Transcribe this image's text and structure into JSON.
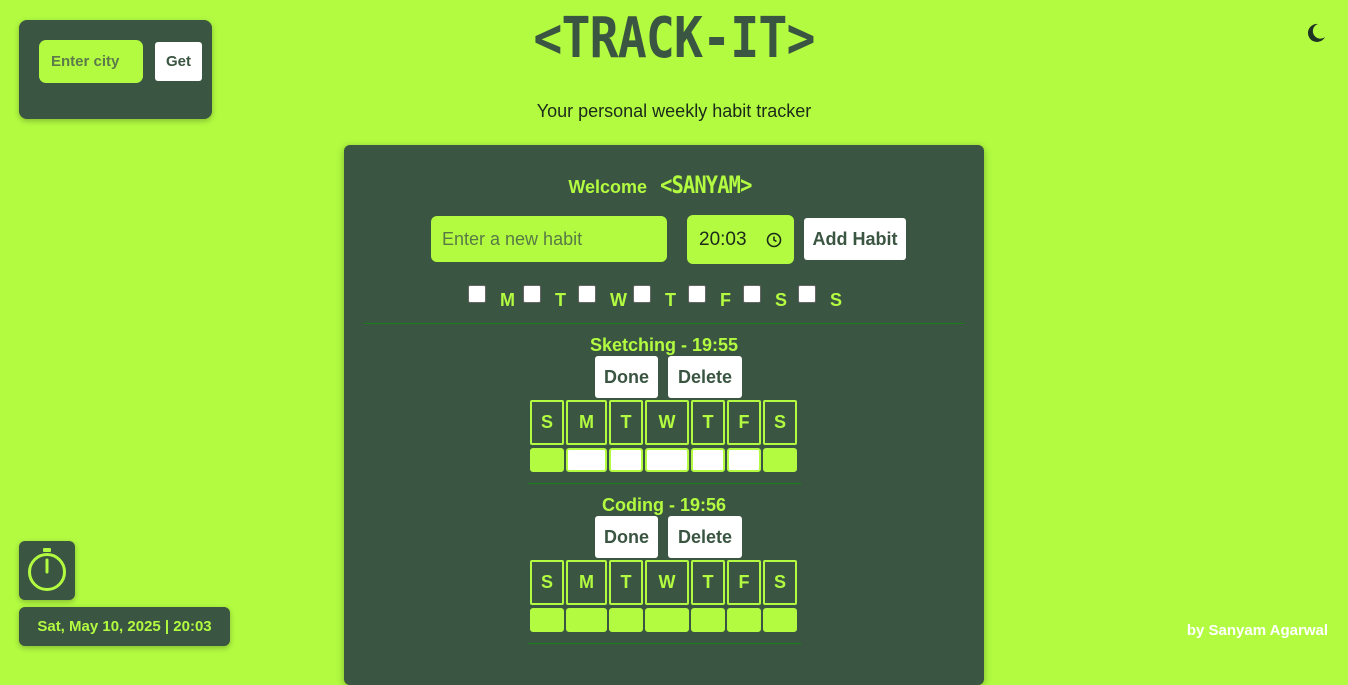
{
  "header": {
    "title": "<TRACK-IT>",
    "subtitle": "Your personal weekly habit tracker",
    "dark_mode_icon": "moon-icon"
  },
  "weather": {
    "city_placeholder": "Enter city",
    "get_label": "Get"
  },
  "panel": {
    "welcome_label": "Welcome",
    "username": "<SANYAM>",
    "habit_placeholder": "Enter a new habit",
    "time_value": "20:03",
    "clock_icon": "clock-icon",
    "add_label": "Add Habit",
    "day_options": [
      "M",
      "T",
      "W",
      "T",
      "F",
      "S",
      "S"
    ]
  },
  "habits": [
    {
      "title": "Sketching - 19:55",
      "done_label": "Done",
      "delete_label": "Delete",
      "days": [
        "S",
        "M",
        "T",
        "W",
        "T",
        "F",
        "S"
      ],
      "scheduled": [
        false,
        true,
        true,
        true,
        true,
        true,
        false
      ]
    },
    {
      "title": "Coding - 19:56",
      "done_label": "Done",
      "delete_label": "Delete",
      "days": [
        "S",
        "M",
        "T",
        "W",
        "T",
        "F",
        "S"
      ],
      "scheduled": [
        false,
        false,
        false,
        false,
        false,
        false,
        false
      ]
    }
  ],
  "footer": {
    "timer_icon": "stopwatch-icon",
    "datetime": "Sat, May 10, 2025 | 20:03",
    "credit": "by Sanyam Agarwal"
  },
  "colors": {
    "background": "#b2fb41",
    "panel": "#3a5541",
    "accent": "#b2fb41"
  }
}
